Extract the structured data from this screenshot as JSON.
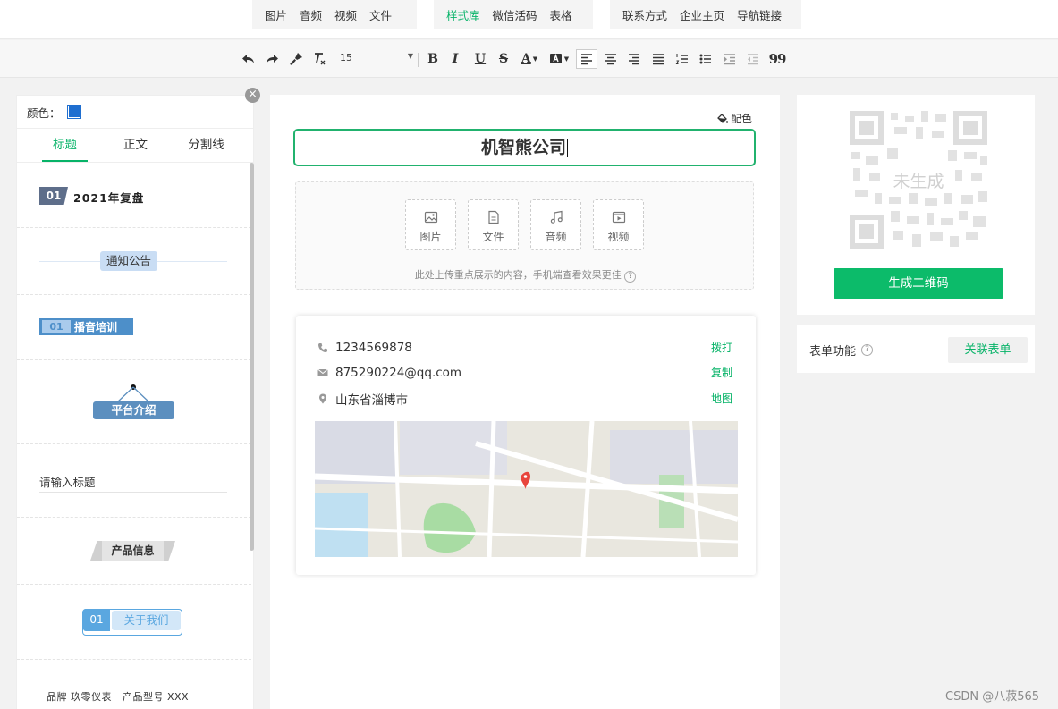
{
  "top_tabs": {
    "group1": [
      "图片",
      "音频",
      "视频",
      "文件"
    ],
    "group2": [
      "样式库",
      "微信活码",
      "表格"
    ],
    "group3": [
      "联系方式",
      "企业主页",
      "导航链接"
    ],
    "active": "样式库"
  },
  "toolbar": {
    "font_size": "15",
    "bold_glyph": "B",
    "italic_glyph": "I",
    "underline_glyph": "U",
    "strike_glyph": "S",
    "font_color_glyph": "A",
    "quote_glyph": "99"
  },
  "left_panel": {
    "close_glyph": "×",
    "color_label": "颜色：",
    "swatch_color": "#1f6fd0",
    "tabs": [
      "标题",
      "正文",
      "分割线"
    ],
    "active_tab": "标题",
    "templates": {
      "t1_num": "01",
      "t1_text": "2021年复盘",
      "t2_text": "通知公告",
      "t3_num": "01",
      "t3_text": "播音培训",
      "t4_text": "平台介绍",
      "t5_text": "请输入标题",
      "t6_text": "产品信息",
      "t7_num": "01",
      "t7_text": "关于我们",
      "t8_text": "品牌 玖零仪表   产品型号 XXX"
    }
  },
  "editor": {
    "palette_label": "配色",
    "title_value": "机智熊公司",
    "media_buttons": [
      "图片",
      "文件",
      "音频",
      "视频"
    ],
    "media_hint": "此处上传重点展示的内容，手机端查看效果更佳",
    "contacts": [
      {
        "icon": "phone-icon",
        "text": "1234569878",
        "action": "拨打"
      },
      {
        "icon": "mail-icon",
        "text": "875290224@qq.com",
        "action": "复制"
      },
      {
        "icon": "location-icon",
        "text": "山东省淄博市",
        "action": "地图"
      }
    ]
  },
  "qr": {
    "placeholder_text": "未生成",
    "button_label": "生成二维码"
  },
  "form": {
    "label": "表单功能",
    "help_glyph": "?",
    "button_label": "关联表单"
  },
  "watermark": "CSDN @八菽565",
  "colors": {
    "accent": "#07b368",
    "primary_button": "#0cbb6a",
    "title_border": "#21b26e"
  }
}
